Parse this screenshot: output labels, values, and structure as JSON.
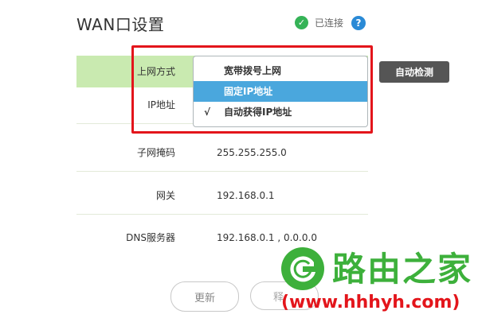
{
  "page": {
    "title": "WAN口设置",
    "status_text": "已连接",
    "help_glyph": "?"
  },
  "form": {
    "connection_type_label": "上网方式",
    "ip_label": "IP地址",
    "mask_label": "子网掩码",
    "mask_value": "255.255.255.0",
    "gateway_label": "网关",
    "gateway_value": "192.168.0.1",
    "dns_label": "DNS服务器",
    "dns_value": "192.168.0.1 , 0.0.0.0"
  },
  "dropdown": {
    "options": [
      {
        "label": "宽带拨号上网"
      },
      {
        "label": "固定IP地址"
      },
      {
        "label": "自动获得IP地址"
      }
    ],
    "hovered_index": 1,
    "selected_index": 2,
    "check_glyph": "√"
  },
  "actions": {
    "auto_detect_label": "自动检测",
    "refresh_label": "更新",
    "release_label_partial": "释"
  },
  "watermark": {
    "brand": "路由之家",
    "url": "(www.hhhyh.com)"
  },
  "colors": {
    "accent_green": "#35b357",
    "row_highlight": "#c9eab0",
    "hover_blue": "#4aa7dd",
    "annotation_red": "#e3151b",
    "help_blue": "#2a8ad6"
  },
  "icons": {
    "status": "check-circle-icon",
    "help": "question-circle-icon"
  }
}
